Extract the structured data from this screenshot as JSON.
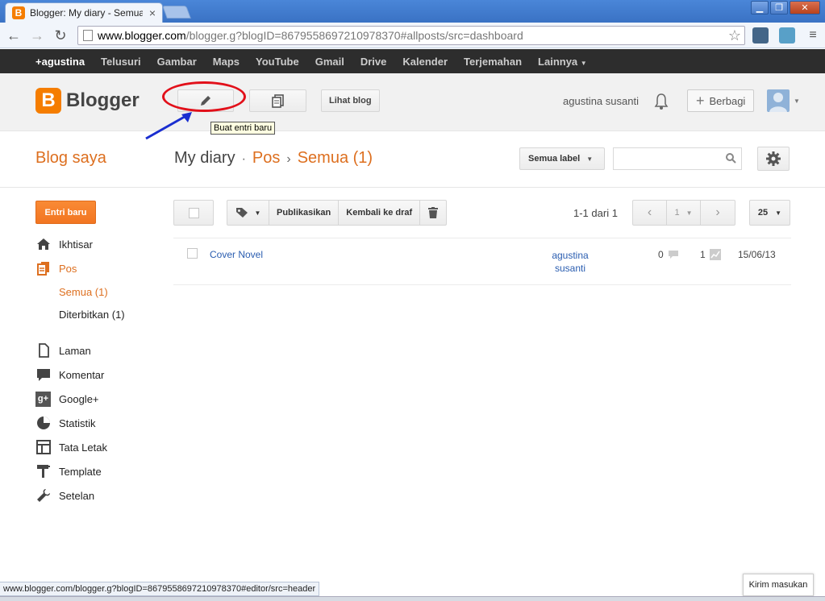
{
  "browser": {
    "tab_title": "Blogger: My diary - Semua en",
    "url_host": "www.blogger.com",
    "url_path": "/blogger.g?blogID=8679558697210978370#allposts/src=dashboard",
    "status_url": "www.blogger.com/blogger.g?blogID=8679558697210978370#editor/src=header"
  },
  "gbar": {
    "items": [
      "+agustina",
      "Telusuri",
      "Gambar",
      "Maps",
      "YouTube",
      "Gmail",
      "Drive",
      "Kalender",
      "Terjemahan",
      "Lainnya"
    ]
  },
  "header": {
    "logo_text": "Blogger",
    "view_blog": "Lihat blog",
    "tooltip": "Buat entri baru",
    "user_name": "agustina susanti",
    "share_label": "Berbagi"
  },
  "page": {
    "my_blogs": "Blog saya",
    "blog_name": "My diary",
    "crumb_posts": "Pos",
    "crumb_all": "Semua (1)",
    "label_select": "Semua label"
  },
  "sidebar": {
    "new_post": "Entri baru",
    "items": [
      {
        "label": "Ikhtisar",
        "icon": "home-icon"
      },
      {
        "label": "Pos",
        "icon": "posts-icon"
      },
      {
        "label": "Laman",
        "icon": "pages-icon"
      },
      {
        "label": "Komentar",
        "icon": "comments-icon"
      },
      {
        "label": "Google+",
        "icon": "google-plus-icon"
      },
      {
        "label": "Statistik",
        "icon": "stats-icon"
      },
      {
        "label": "Tata Letak",
        "icon": "layout-icon"
      },
      {
        "label": "Template",
        "icon": "template-icon"
      },
      {
        "label": "Setelan",
        "icon": "wrench-icon"
      }
    ],
    "sub_all": "Semua (1)",
    "sub_published": "Diterbitkan (1)"
  },
  "posts": {
    "publish": "Publikasikan",
    "revert_draft": "Kembali ke draf",
    "range": "1-1 dari 1",
    "page": "1",
    "per_page": "25",
    "rows": [
      {
        "title": "Cover Novel",
        "author": "agustina susanti",
        "comments": "0",
        "views": "1",
        "date": "15/06/13"
      }
    ]
  },
  "footer": {
    "feedback": "Kirim masukan"
  },
  "colors": {
    "accent": "#dd6f1f",
    "link": "#2a5db0",
    "annotation": "#e2101a"
  }
}
